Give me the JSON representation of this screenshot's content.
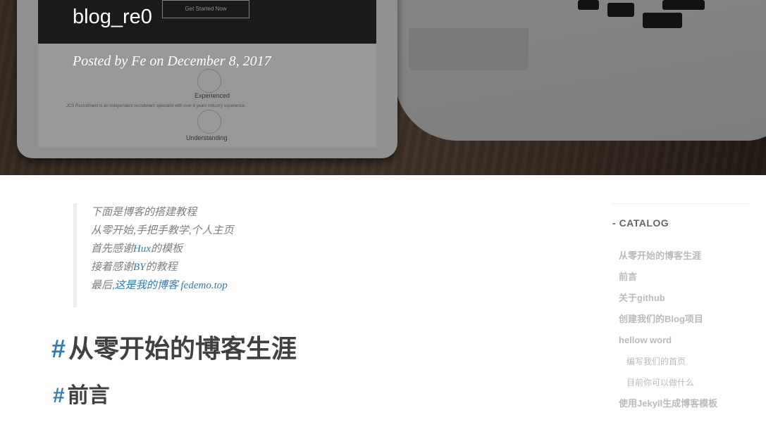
{
  "hero": {
    "title": "blog_re0",
    "meta": "Posted by Fe on December 8, 2017",
    "tablet_button": "Get Started Now",
    "tablet_label_1": "Experienced",
    "tablet_label_2": "Understanding",
    "tablet_small": "JCS Recruitment is an independent recruitment specialist with over 8 years industry experience."
  },
  "quote": {
    "line1": "下面是博客的搭建教程",
    "line2": "从零开始,手把手教学,个人主页",
    "line3_pre": "首先感谢",
    "line3_link": "Hux",
    "line3_post": "的模板",
    "line4_pre": "接着感谢",
    "line4_link": "BY",
    "line4_post": "的教程",
    "line5_pre": "最后,",
    "line5_link": "这是我的博客 fedemo.top"
  },
  "headings": {
    "h1": "从零开始的博客生涯",
    "h2": "前言",
    "hash": "#"
  },
  "catalog": {
    "title": "CATALOG",
    "items": [
      {
        "label": "从零开始的博客生涯",
        "level": 1
      },
      {
        "label": "前言",
        "level": 2
      },
      {
        "label": "关于github",
        "level": 2
      },
      {
        "label": "创建我们的Blog项目",
        "level": 2
      },
      {
        "label": "hellow word",
        "level": 2
      },
      {
        "label": "编写我们的首页",
        "level": 3
      },
      {
        "label": "目前你可以做什么",
        "level": 3
      },
      {
        "label": "使用Jekyll生成博客模板",
        "level": 2
      }
    ]
  },
  "colors": {
    "link": "#337ab7",
    "text": "#404040",
    "sidebar_text": "#bbbbbb"
  }
}
